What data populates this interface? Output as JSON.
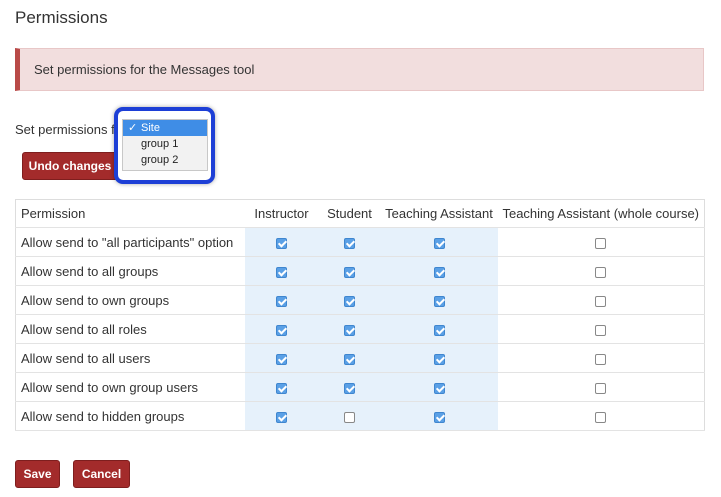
{
  "page": {
    "title": "Permissions"
  },
  "alert": {
    "text": "Set permissions for the Messages tool"
  },
  "set_for": {
    "label": "Set permissions f",
    "options": [
      "Site",
      "group 1",
      "group 2"
    ],
    "selected": "Site",
    "check_glyph": "✓"
  },
  "undo_label": "Undo changes",
  "table": {
    "columns": [
      "Permission",
      "Instructor",
      "Student",
      "Teaching Assistant",
      "Teaching Assistant (whole course)"
    ],
    "rows": [
      {
        "label": "Allow send to \"all participants\" option",
        "checks": [
          true,
          true,
          true,
          false
        ]
      },
      {
        "label": "Allow send to all groups",
        "checks": [
          true,
          true,
          true,
          false
        ]
      },
      {
        "label": "Allow send to own groups",
        "checks": [
          true,
          true,
          true,
          false
        ]
      },
      {
        "label": "Allow send to all roles",
        "checks": [
          true,
          true,
          true,
          false
        ]
      },
      {
        "label": "Allow send to all users",
        "checks": [
          true,
          true,
          true,
          false
        ]
      },
      {
        "label": "Allow send to own group users",
        "checks": [
          true,
          true,
          true,
          false
        ]
      },
      {
        "label": "Allow send to hidden groups",
        "checks": [
          true,
          false,
          true,
          false
        ]
      }
    ]
  },
  "footer": {
    "save_label": "Save",
    "cancel_label": "Cancel"
  },
  "colors": {
    "accent": "#a32b2b",
    "highlight": "#1d3fd6",
    "shade": "#e6f1fb"
  }
}
